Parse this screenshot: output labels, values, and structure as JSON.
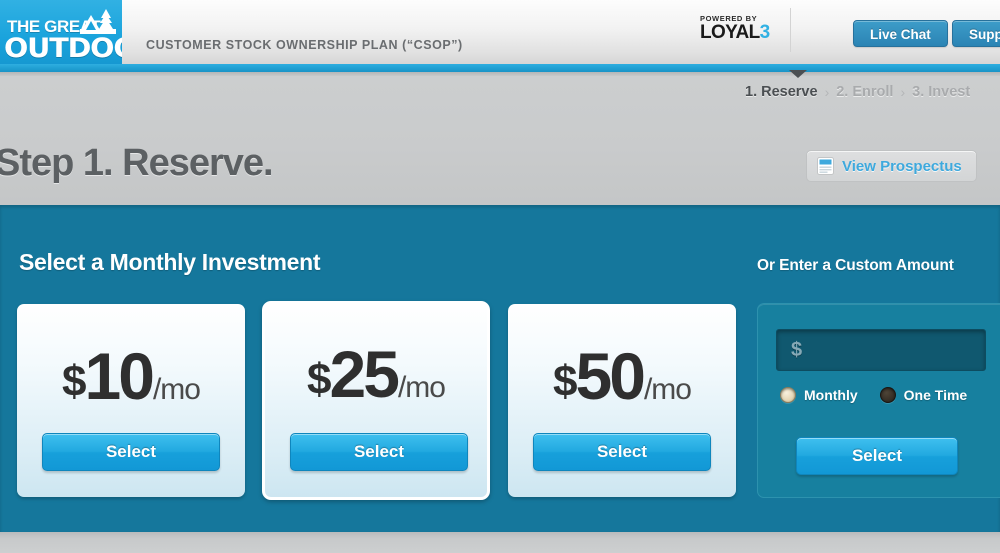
{
  "header": {
    "brand_line1": "THE GREAT",
    "brand_line2": "OUTDOORS",
    "subtitle": "CUSTOMER STOCK OWNERSHIP PLAN (“CSOP”)",
    "powered_by": "POWERED BY",
    "loyal_name": "LOYAL",
    "loyal_number": "3",
    "live_chat_label": "Live Chat",
    "support_label": "Support",
    "brand_color": "#1aa3dc",
    "button_color": "#2b84b4"
  },
  "breadcrumb": {
    "steps": [
      {
        "label": "1. Reserve",
        "active": true
      },
      {
        "label": "2. Enroll",
        "active": false
      },
      {
        "label": "3. Invest",
        "active": false
      }
    ],
    "separator": "›"
  },
  "title_band": {
    "step_title": "Step 1. Reserve.",
    "prospectus_label": "View Prospectus",
    "prospectus_icon": "document-icon",
    "prospectus_link_color": "#3ea9dd"
  },
  "panel": {
    "heading": "Select a Monthly Investment",
    "custom_heading": "Or Enter a Custom Amount",
    "background_color": "#15779c",
    "cards": [
      {
        "dollar_sign": "$",
        "amount": "10",
        "period": "/mo",
        "select_label": "Select",
        "highlighted": false
      },
      {
        "dollar_sign": "$",
        "amount": "25",
        "period": "/mo",
        "select_label": "Select",
        "highlighted": true
      },
      {
        "dollar_sign": "$",
        "amount": "50",
        "period": "/mo",
        "select_label": "Select",
        "highlighted": false
      }
    ],
    "custom": {
      "input_value": "",
      "input_placeholder": "$",
      "frequency_options": [
        {
          "label": "Monthly",
          "selected": true
        },
        {
          "label": "One Time",
          "selected": false
        }
      ],
      "select_label": "Select"
    }
  }
}
